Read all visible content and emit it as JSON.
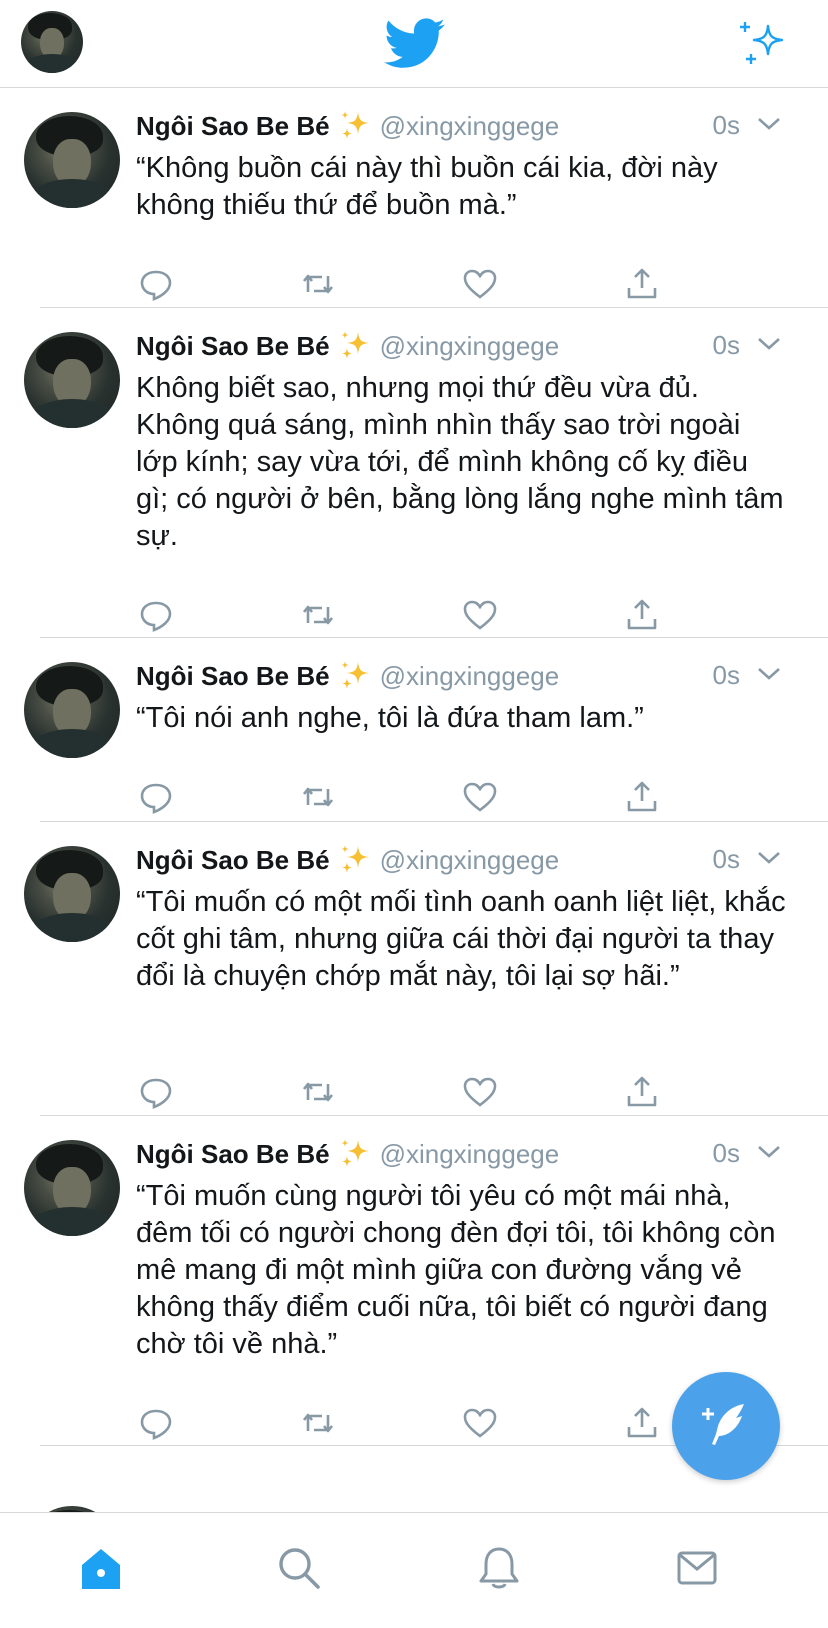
{
  "colors": {
    "accent": "#1da1f2",
    "icon_gray": "#8899a6",
    "fab": "#4ba2ea"
  },
  "header": {
    "logo_icon": "twitter-bird-icon",
    "right_icon": "sparkle-icon"
  },
  "tweets": [
    {
      "name": "Ngôi Sao Be Bé",
      "emoji": "✨",
      "handle": "@xingxinggege",
      "time": "0s",
      "text": "“Không buồn cái này thì buồn cái kia, đời này không thiếu thứ để buồn mà.”"
    },
    {
      "name": "Ngôi Sao Be Bé",
      "emoji": "✨",
      "handle": "@xingxinggege",
      "time": "0s",
      "text": "Không biết sao, nhưng mọi thứ đều vừa đủ. Không quá sáng, mình nhìn thấy sao trời ngoài lớp kính; say vừa tới, để mình không cố kỵ điều gì; có người ở bên, bằng lòng lắng nghe mình tâm sự."
    },
    {
      "name": "Ngôi Sao Be Bé",
      "emoji": "✨",
      "handle": "@xingxinggege",
      "time": "0s",
      "text": "“Tôi nói anh nghe, tôi là đứa tham lam.”"
    },
    {
      "name": "Ngôi Sao Be Bé",
      "emoji": "✨",
      "handle": "@xingxinggege",
      "time": "0s",
      "text": "“Tôi muốn có một mối tình oanh oanh liệt liệt, khắc cốt ghi tâm, nhưng giữa cái thời đại người ta thay đổi là chuyện chớp mắt này, tôi lại sợ hãi.”"
    },
    {
      "name": "Ngôi Sao Be Bé",
      "emoji": "✨",
      "handle": "@xingxinggege",
      "time": "0s",
      "text": "“Tôi muốn cùng người tôi yêu có một mái nhà, đêm tối có người chong đèn đợi tôi, tôi không còn mê mang đi một mình giữa con đường vắng vẻ không thấy điểm cuối nữa, tôi biết có người đang chờ tôi về nhà.”"
    }
  ],
  "tabs": [
    "home",
    "search",
    "notifications",
    "messages"
  ]
}
